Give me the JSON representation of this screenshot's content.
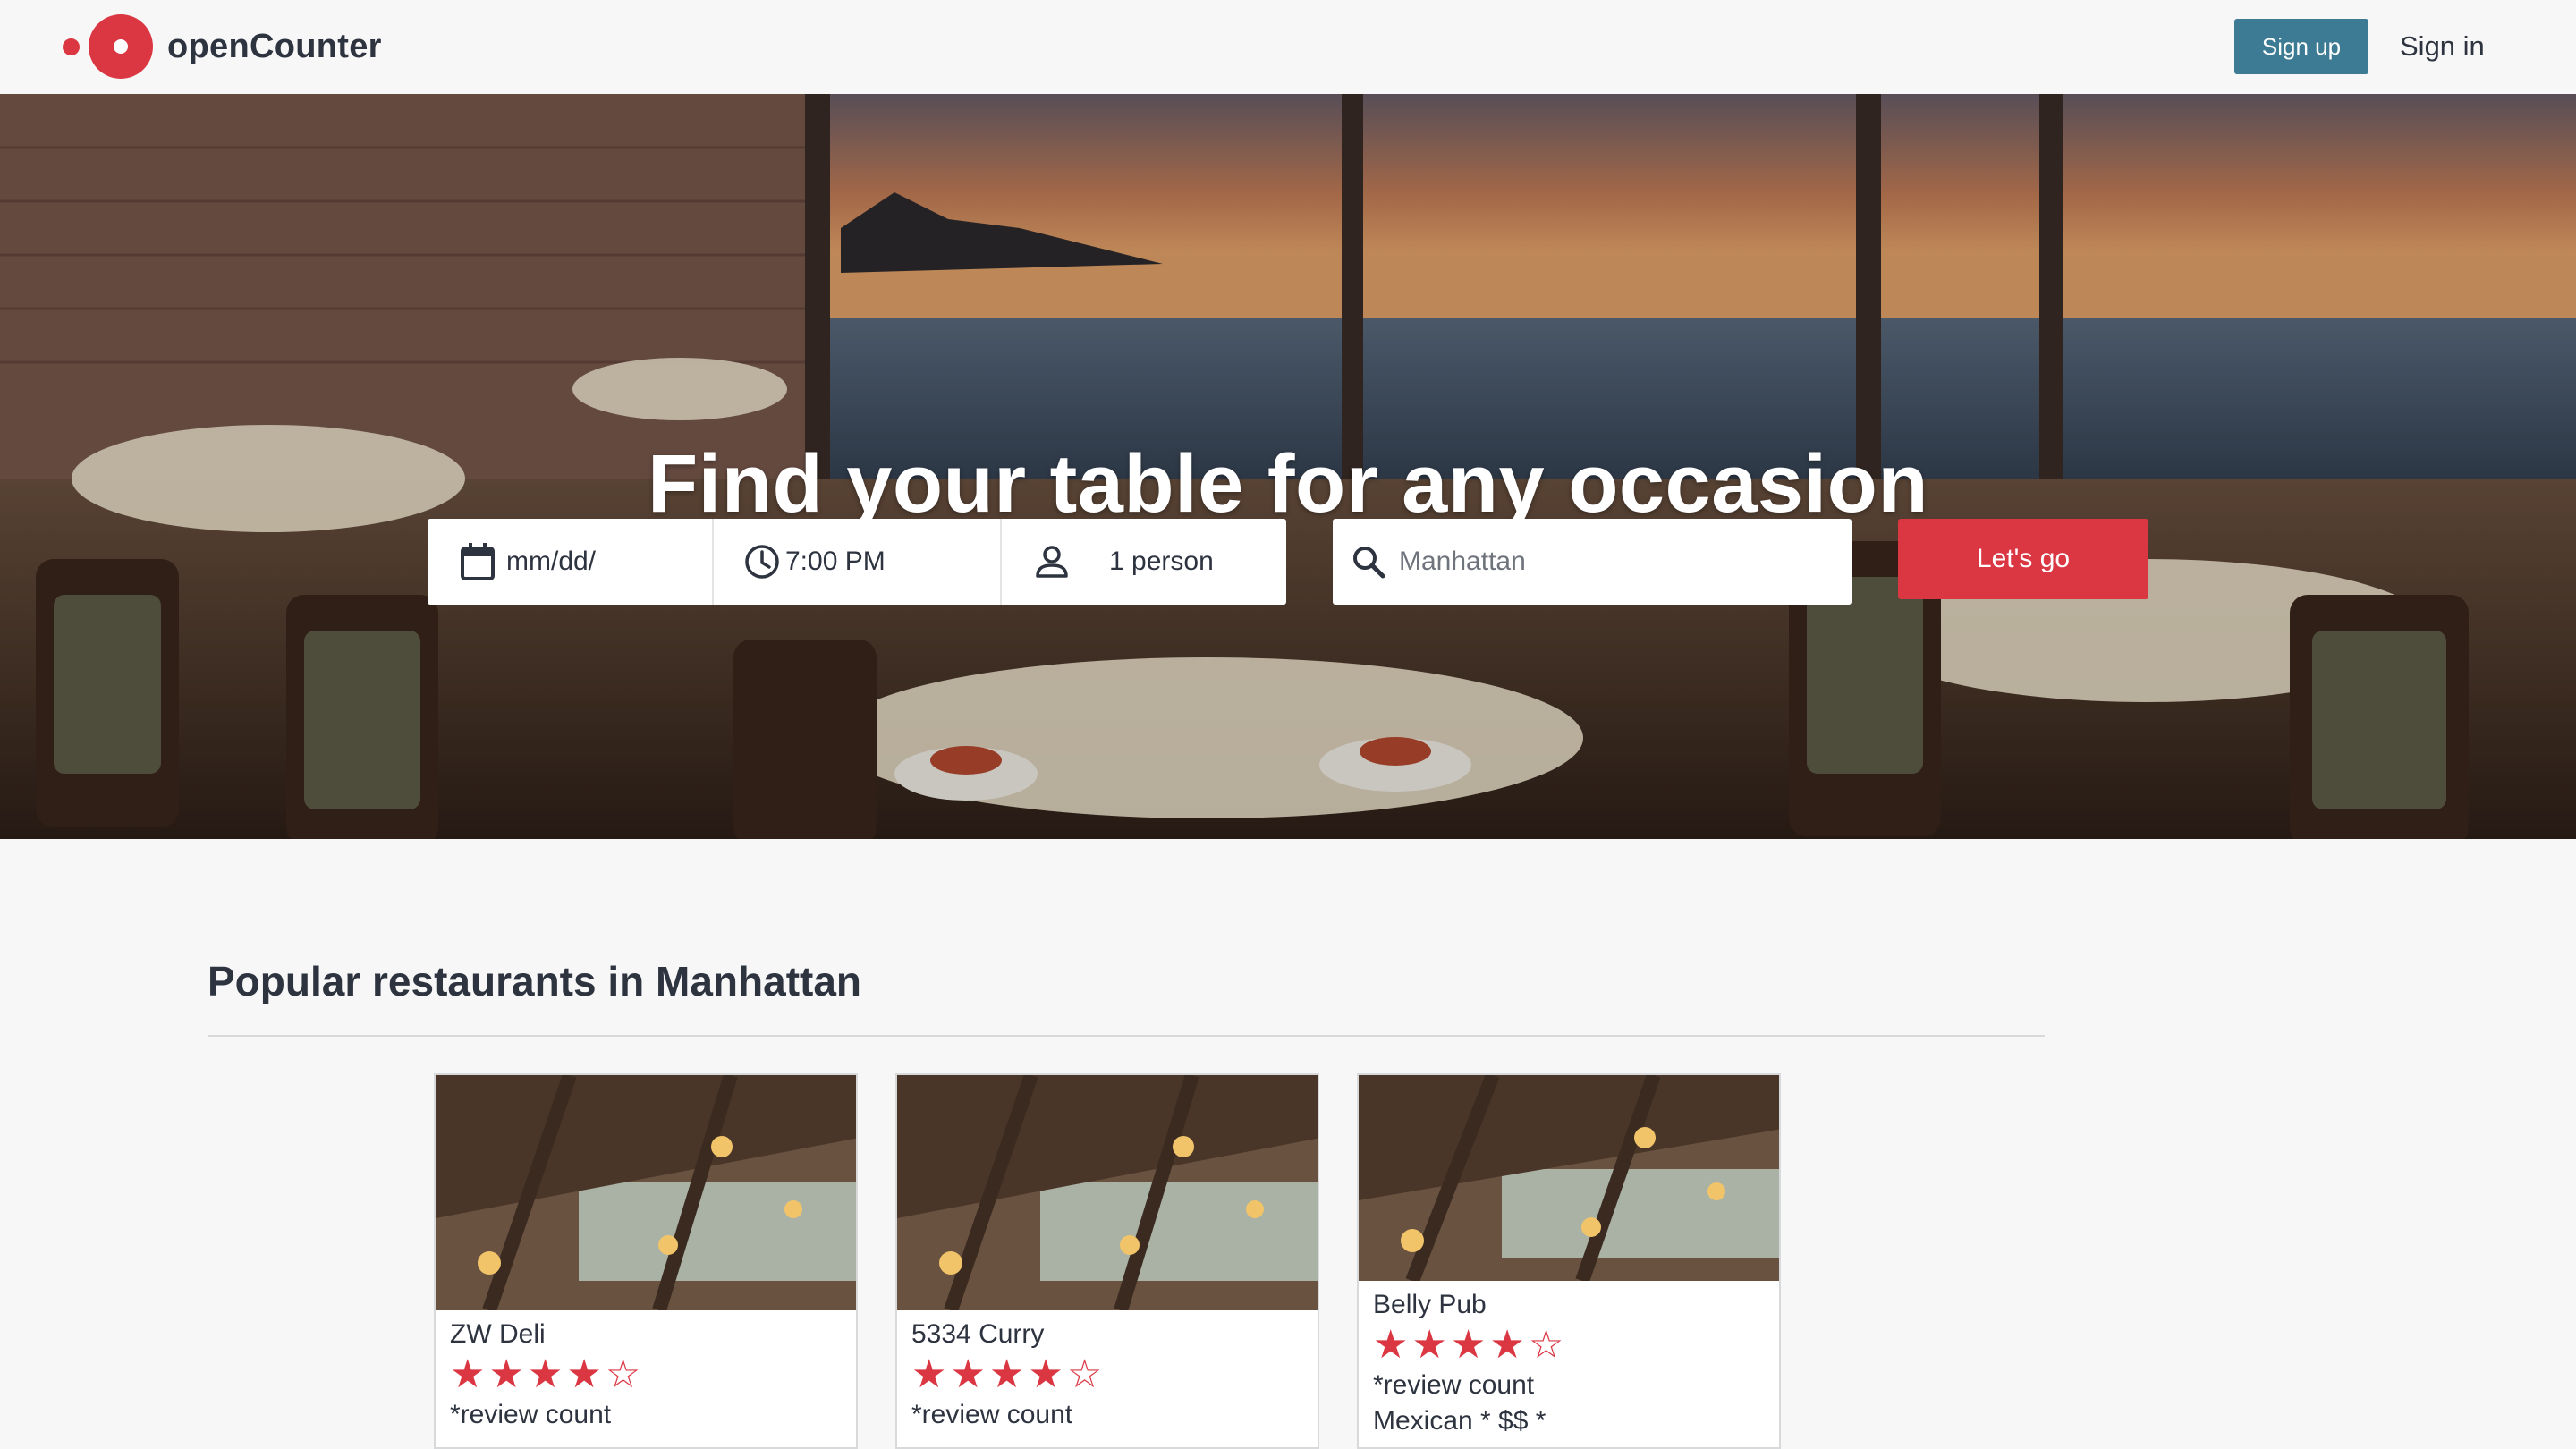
{
  "brand": {
    "name": "openCounter",
    "accent": "#da3743",
    "secondary": "#3d7b94"
  },
  "nav": {
    "signup_label": "Sign up",
    "signin_label": "Sign in"
  },
  "hero": {
    "title": "Find your table for any occasion",
    "date_placeholder": "mm/dd/",
    "time_value": "7:00 PM",
    "party_value": "1 person",
    "location_placeholder": "Manhattan",
    "submit_label": "Let's go"
  },
  "popular": {
    "title": "Popular restaurants in Manhattan",
    "restaurants": [
      {
        "name": "ZW Deli",
        "rating": 4.5,
        "review_text": "*review count"
      },
      {
        "name": "5334 Curry",
        "rating": 4.5,
        "review_text": "*review count"
      },
      {
        "name": "Belly Pub",
        "rating": 4.5,
        "review_text": "*review count",
        "meta_text": "Mexican * $$ *"
      }
    ]
  }
}
